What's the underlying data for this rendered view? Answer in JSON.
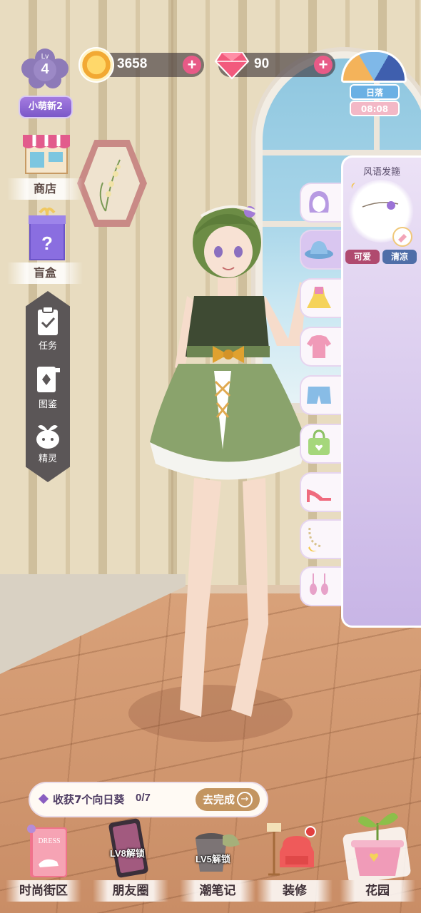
{
  "player": {
    "level_label": "Lv",
    "level": "4",
    "name": "小萌新2"
  },
  "currency": {
    "coins": "3658",
    "gems": "90",
    "plus_symbol": "+"
  },
  "time": {
    "phase": "日落",
    "clock": "08:08"
  },
  "side_menu": {
    "shop": "商店",
    "blind_box": "盲盒",
    "tasks": "任务",
    "catalog": "图鉴",
    "sprite": "精灵"
  },
  "wardrobe": {
    "selected_item_name": "风语发箍",
    "tags": [
      "可爱",
      "清凉"
    ],
    "tabs": [
      "hair",
      "hat",
      "dress",
      "top",
      "bottom",
      "bag",
      "shoes",
      "necklace",
      "earrings"
    ]
  },
  "quest": {
    "text": "收获7个向日葵",
    "progress": "0/7",
    "action": "去完成",
    "arrow": "→"
  },
  "bottom_nav": {
    "fashion_street": "时尚街区",
    "friends": "朋友圈",
    "friends_lock": "LV8解锁",
    "trend_notes": "潮笔记",
    "trend_notes_lock": "LV5解锁",
    "decorate": "装修",
    "garden": "花园",
    "dress_book_text": "DRESS"
  },
  "colors": {
    "accent_purple": "#8a5ec0",
    "plus_pink": "#e85a87",
    "tag_cute": "#b04a6f",
    "tag_cool": "#4f6ea8",
    "quest_button": "#c39561"
  }
}
